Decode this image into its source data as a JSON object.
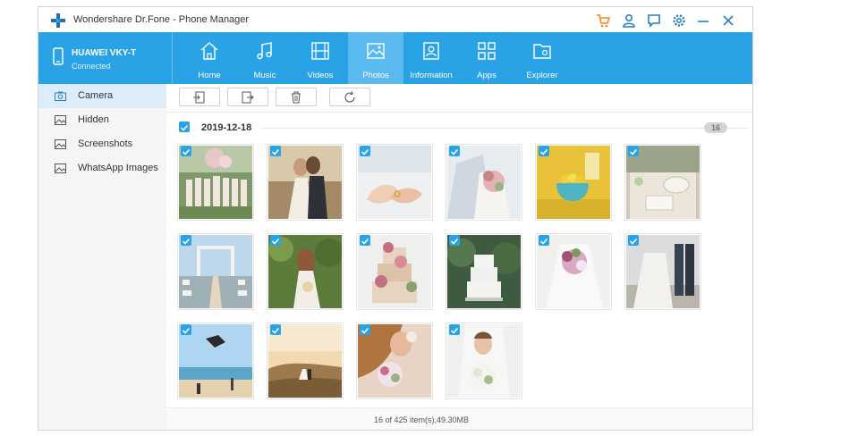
{
  "titlebar": {
    "title": "Wondershare Dr.Fone - Phone Manager",
    "brand_color": "#2aa3e6",
    "icons": [
      "cart-icon",
      "user-icon",
      "feedback-icon",
      "settings-icon",
      "minimize-icon",
      "close-icon"
    ]
  },
  "device": {
    "name": "HUAWEI VKY-T",
    "status": "Connected"
  },
  "nav": {
    "tabs": [
      {
        "label": "Home",
        "icon": "home-icon"
      },
      {
        "label": "Music",
        "icon": "music-icon"
      },
      {
        "label": "Videos",
        "icon": "video-icon"
      },
      {
        "label": "Photos",
        "icon": "photo-icon",
        "active": true
      },
      {
        "label": "Information",
        "icon": "contact-icon"
      },
      {
        "label": "Apps",
        "icon": "apps-icon"
      },
      {
        "label": "Explorer",
        "icon": "folder-icon"
      }
    ]
  },
  "sidebar": {
    "items": [
      {
        "label": "Camera",
        "icon": "camera-icon",
        "active": true
      },
      {
        "label": "Hidden",
        "icon": "image-icon"
      },
      {
        "label": "Screenshots",
        "icon": "image-icon"
      },
      {
        "label": "WhatsApp Images",
        "icon": "image-icon"
      }
    ]
  },
  "toolbar": {
    "buttons": [
      "import-icon",
      "export-icon",
      "delete-icon",
      "refresh-icon"
    ]
  },
  "group": {
    "date": "2019-12-18",
    "count": "16",
    "photos": [
      {
        "checked": true
      },
      {
        "checked": true
      },
      {
        "checked": true
      },
      {
        "checked": true
      },
      {
        "checked": true
      },
      {
        "checked": true
      },
      {
        "checked": true
      },
      {
        "checked": true
      },
      {
        "checked": true
      },
      {
        "checked": true
      },
      {
        "checked": true
      },
      {
        "checked": true
      },
      {
        "checked": true
      },
      {
        "checked": true
      },
      {
        "checked": true
      },
      {
        "checked": true
      }
    ]
  },
  "status": {
    "text": "16 of 425 item(s),49.30MB"
  }
}
